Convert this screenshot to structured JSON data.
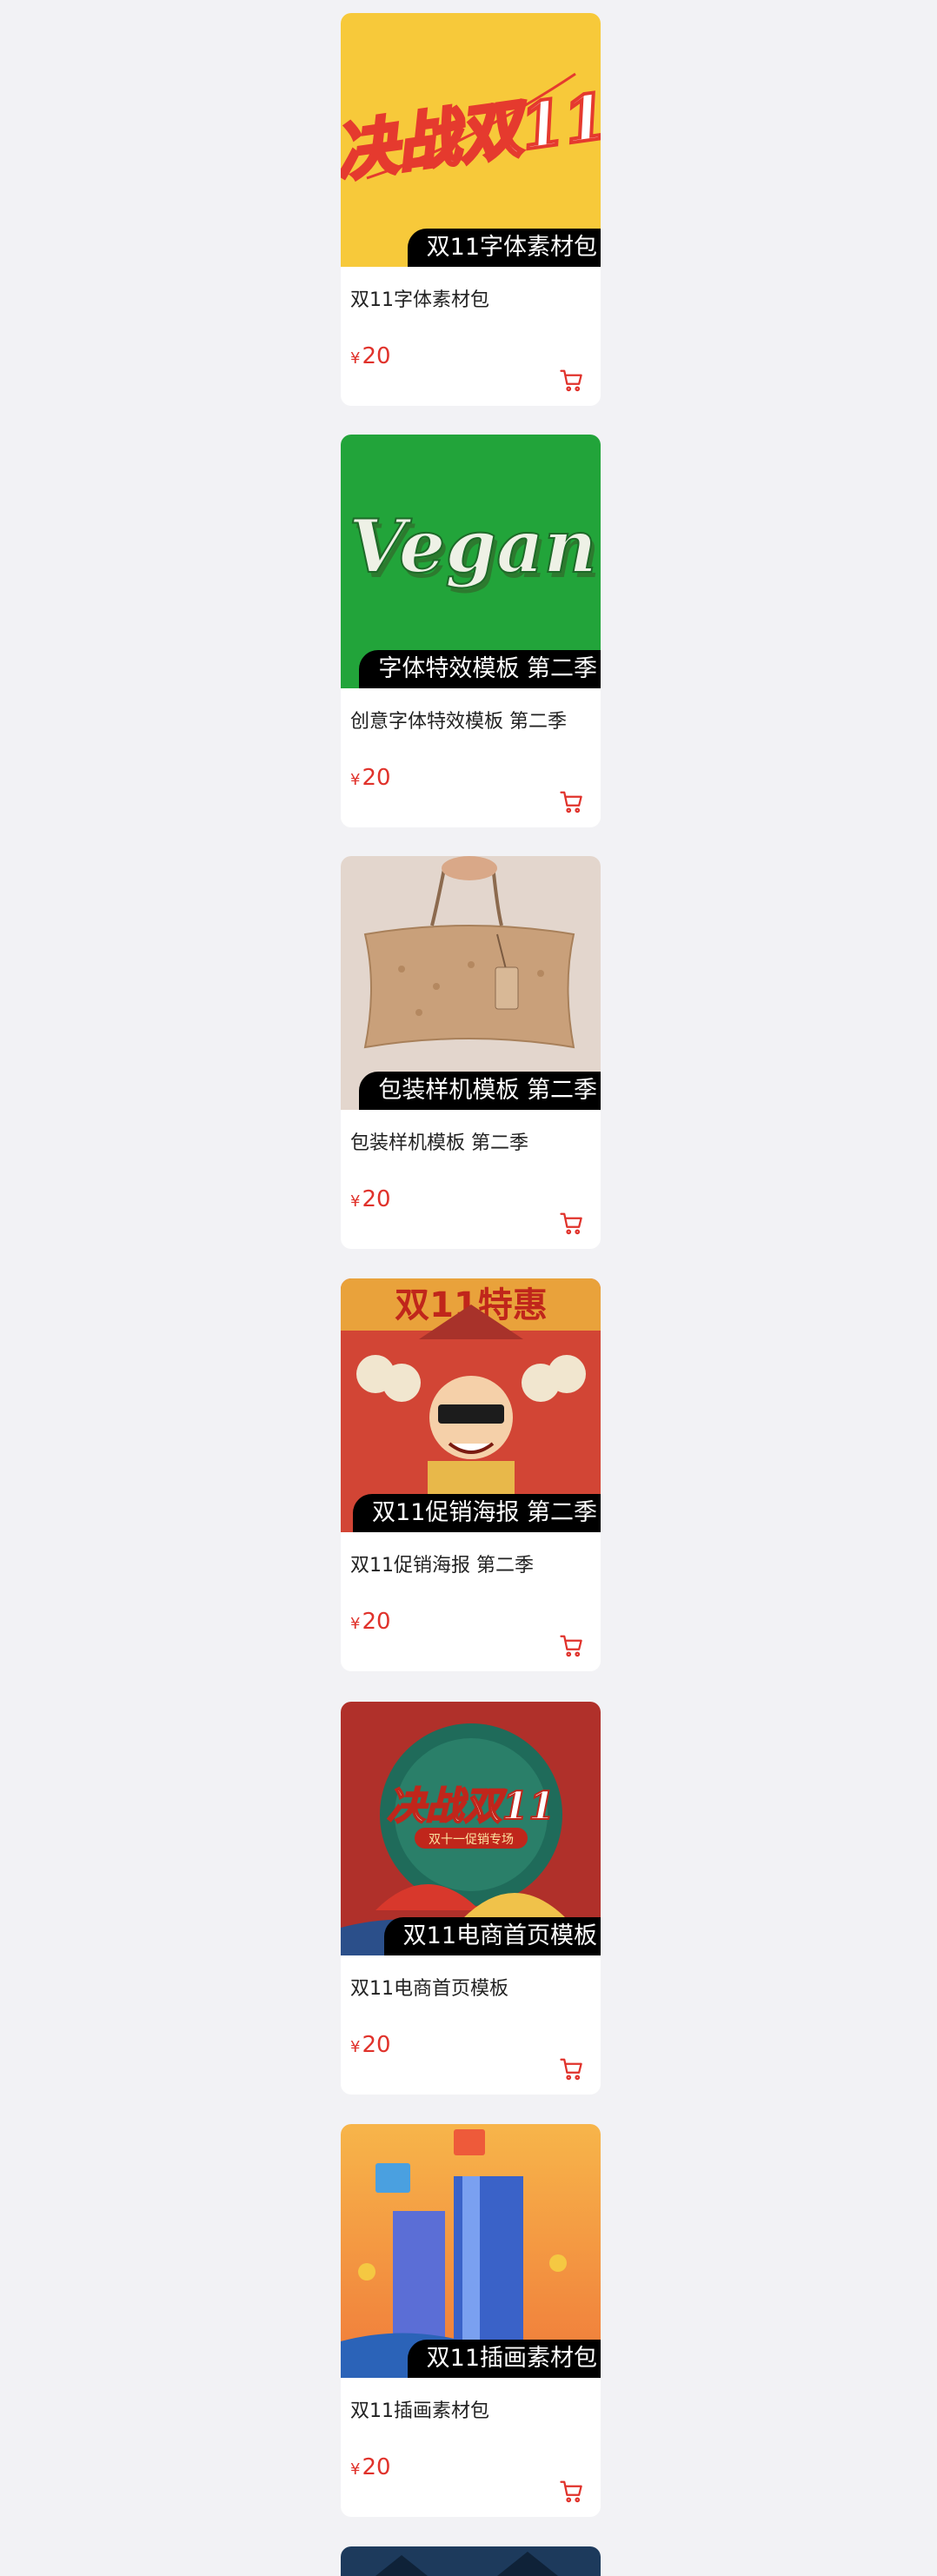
{
  "colors": {
    "price": "#e0322b",
    "background": "#f2f2f5",
    "badge": "#000000"
  },
  "products": [
    {
      "badge": "双11字体素材包",
      "title": "双11字体素材包",
      "currency": "¥",
      "price": "20",
      "art_text": "决战双11"
    },
    {
      "badge": "字体特效模板 第二季",
      "title": "创意字体特效模板 第二季",
      "currency": "¥",
      "price": "20",
      "art_text": "Vegan"
    },
    {
      "badge": "包装样机模板 第二季",
      "title": "包装样机模板 第二季",
      "currency": "¥",
      "price": "20"
    },
    {
      "badge": "双11促销海报 第二季",
      "title": "双11促销海报 第二季",
      "currency": "¥",
      "price": "20",
      "art_text": "双11特惠"
    },
    {
      "badge": "双11电商首页模板",
      "title": "双11电商首页模板",
      "currency": "¥",
      "price": "20",
      "art_text": "决战双11",
      "art_sub": "双十一促销专场"
    },
    {
      "badge": "双11插画素材包",
      "title": "双11插画素材包",
      "currency": "¥",
      "price": "20"
    }
  ],
  "icons": {
    "cart": "shopping-cart-icon"
  }
}
